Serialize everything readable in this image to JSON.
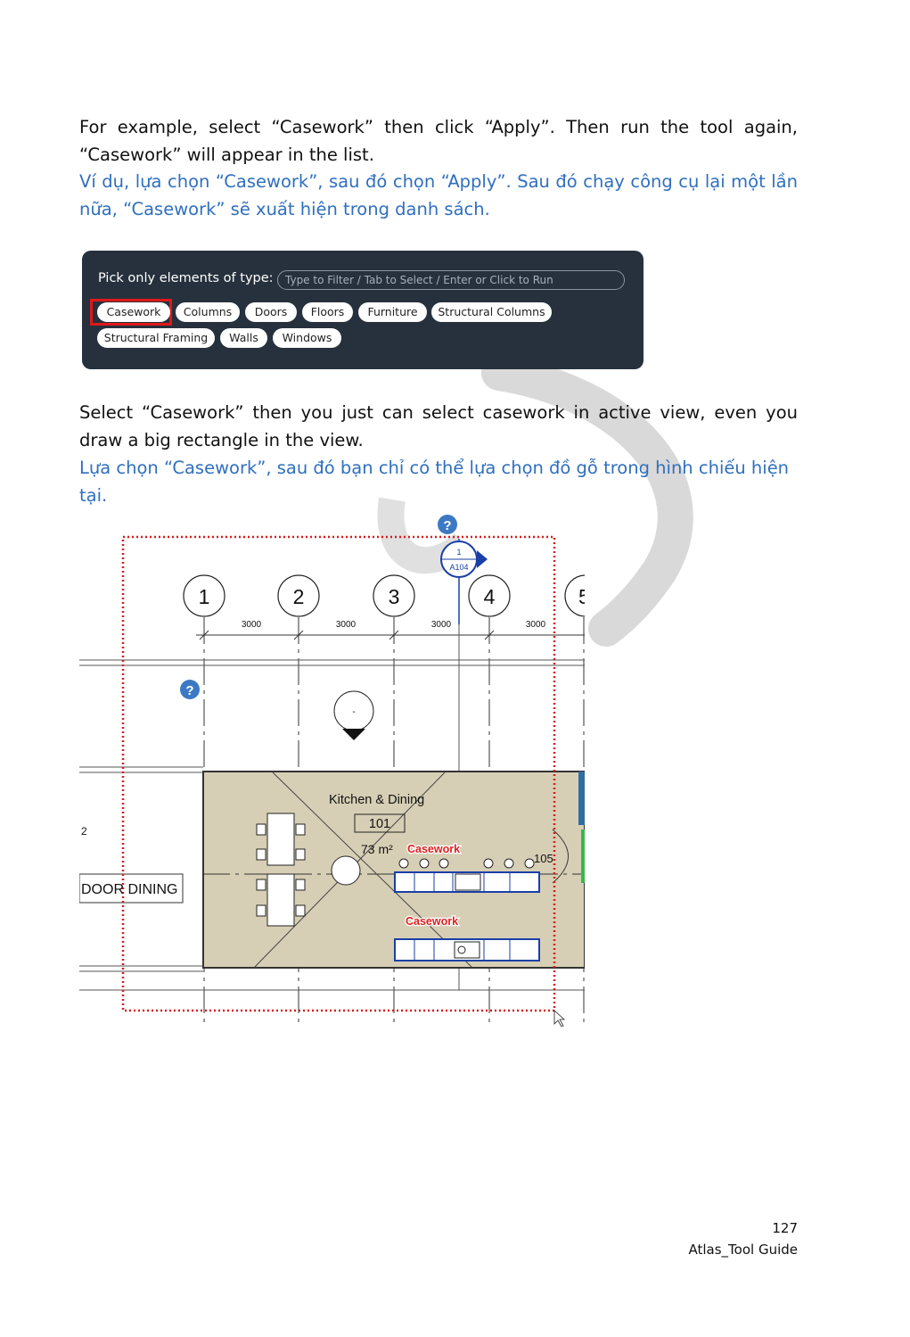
{
  "intro": {
    "en": "For example, select “Casework” then click “Apply”. Then run the tool again, “Casework” will appear in the list.",
    "vi": "Ví dụ, lựa chọn “Casework”, sau đó chọn “Apply”. Sau đó chạy công cụ lại một lần nữa, “Casework” sẽ xuất hiện trong danh sách."
  },
  "dialog": {
    "label": "Pick only elements of type:",
    "search_placeholder": "Type to Filter / Tab to Select / Enter or Click to Run",
    "chips": [
      "Casework",
      "Columns",
      "Doors",
      "Floors",
      "Furniture",
      "Structural Columns",
      "Structural Framing",
      "Walls",
      "Windows"
    ],
    "selected_chip": "Casework"
  },
  "explain": {
    "en": "Select “Casework” then you just can select casework in active view, even you draw a big rectangle in the view.",
    "vi": "Lựa chọn “Casework”, sau đó bạn chỉ có thể lựa chọn đồ gỗ trong hình chiếu hiện tại."
  },
  "plan": {
    "grid_labels": [
      "1",
      "2",
      "3",
      "4",
      "5"
    ],
    "dimensions": [
      "3000",
      "3000",
      "3000",
      "3000"
    ],
    "section_tag": {
      "number": "1",
      "sheet": "A104"
    },
    "room_name": "Kitchen & Dining",
    "room_number": "101",
    "room_area": "73 m²",
    "casework_labels": [
      "Casework",
      "Casework"
    ],
    "door_tag": "105",
    "left_tag": "2",
    "adjacent_room": "DOOR DINING",
    "elev_marker": "-",
    "help_icon": "question-circle-icon"
  },
  "footer": {
    "page_number": "127",
    "doc_name": "Atlas_Tool Guide"
  }
}
